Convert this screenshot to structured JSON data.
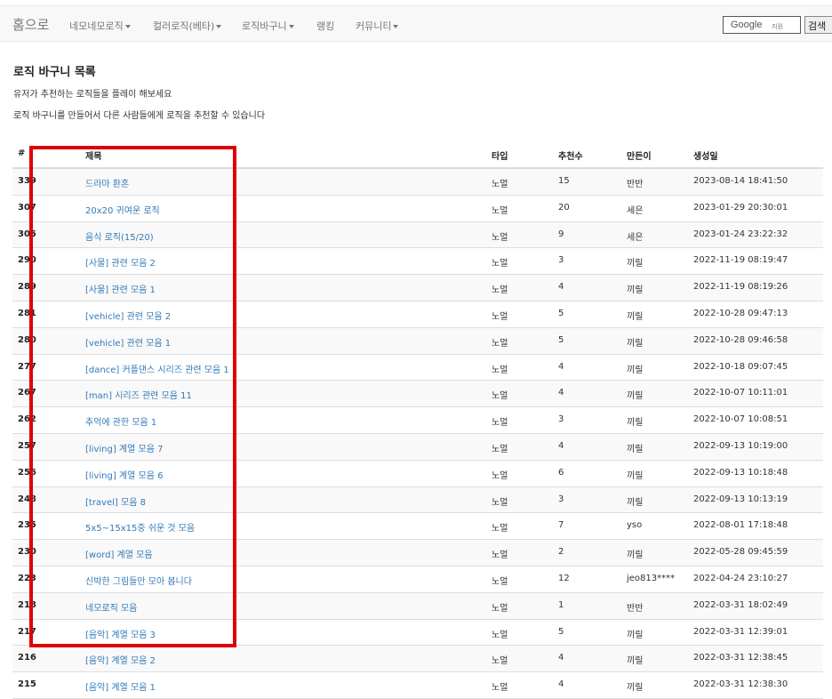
{
  "navbar": {
    "brand": "홈으로",
    "items": [
      {
        "label": "네모네모로직",
        "dropdown": true
      },
      {
        "label": "컬러로직(베타)",
        "dropdown": true
      },
      {
        "label": "로직바구니",
        "dropdown": true
      },
      {
        "label": "랭킹",
        "dropdown": false
      },
      {
        "label": "커뮤니티",
        "dropdown": true
      }
    ],
    "search": {
      "brand": "Google",
      "sub": "지원",
      "button_label": "검색"
    }
  },
  "page": {
    "title": "로직 바구니 목록",
    "desc1": "유저가 추천하는 로직들을 플레이 해보세요",
    "desc2": "로직 바구니를 만들어서 다른 사람들에게 로직을 추천할 수 있습니다"
  },
  "table": {
    "headers": {
      "id": "#",
      "title": "제목",
      "type": "타입",
      "rec": "추천수",
      "author": "만든이",
      "date": "생성일"
    },
    "rows": [
      {
        "id": "339",
        "title": "드라마 환혼",
        "type": "노멀",
        "rec": "15",
        "author": "반반",
        "date": "2023-08-14 18:41:50"
      },
      {
        "id": "307",
        "title": "20x20 귀여운 로직",
        "type": "노멀",
        "rec": "20",
        "author": "세은",
        "date": "2023-01-29 20:30:01"
      },
      {
        "id": "305",
        "title": "음식 로직(15/20)",
        "type": "노멀",
        "rec": "9",
        "author": "세은",
        "date": "2023-01-24 23:22:32"
      },
      {
        "id": "290",
        "title": "[사물] 관련 모음 2",
        "type": "노멀",
        "rec": "3",
        "author": "끼릴",
        "date": "2022-11-19 08:19:47"
      },
      {
        "id": "289",
        "title": "[사물] 관련 모음 1",
        "type": "노멀",
        "rec": "4",
        "author": "끼릴",
        "date": "2022-11-19 08:19:26"
      },
      {
        "id": "281",
        "title": "[vehicle] 관련 모음 2",
        "type": "노멀",
        "rec": "5",
        "author": "끼릴",
        "date": "2022-10-28 09:47:13"
      },
      {
        "id": "280",
        "title": "[vehicle] 관련 모음 1",
        "type": "노멀",
        "rec": "5",
        "author": "끼릴",
        "date": "2022-10-28 09:46:58"
      },
      {
        "id": "277",
        "title": "[dance] 커플댄스 시리즈 관련 모음 1",
        "type": "노멀",
        "rec": "4",
        "author": "끼릴",
        "date": "2022-10-18 09:07:45"
      },
      {
        "id": "267",
        "title": "[man] 시리즈 관련 모음 11",
        "type": "노멀",
        "rec": "4",
        "author": "끼릴",
        "date": "2022-10-07 10:11:01"
      },
      {
        "id": "262",
        "title": "추억에 관한 모음 1",
        "type": "노멀",
        "rec": "3",
        "author": "끼릴",
        "date": "2022-10-07 10:08:51"
      },
      {
        "id": "257",
        "title": "[living] 계열 모음 7",
        "type": "노멀",
        "rec": "4",
        "author": "끼릴",
        "date": "2022-09-13 10:19:00"
      },
      {
        "id": "256",
        "title": "[living] 계열 모음 6",
        "type": "노멀",
        "rec": "6",
        "author": "끼릴",
        "date": "2022-09-13 10:18:48"
      },
      {
        "id": "248",
        "title": "[travel] 모음 8",
        "type": "노멀",
        "rec": "3",
        "author": "끼릴",
        "date": "2022-09-13 10:13:19"
      },
      {
        "id": "235",
        "title": "5x5~15x15중 쉬운 것 모음",
        "type": "노멀",
        "rec": "7",
        "author": "yso",
        "date": "2022-08-01 17:18:48"
      },
      {
        "id": "230",
        "title": "[word] 계열 모음",
        "type": "노멀",
        "rec": "2",
        "author": "끼릴",
        "date": "2022-05-28 09:45:59"
      },
      {
        "id": "223",
        "title": "신박한 그림들만 모아 봅니다",
        "type": "노멀",
        "rec": "12",
        "author": "jeo813****",
        "date": "2022-04-24 23:10:27"
      },
      {
        "id": "218",
        "title": "네모로직 모음",
        "type": "노멀",
        "rec": "1",
        "author": "반반",
        "date": "2022-03-31 18:02:49"
      },
      {
        "id": "217",
        "title": "[음악] 계열 모음 3",
        "type": "노멀",
        "rec": "5",
        "author": "끼릴",
        "date": "2022-03-31 12:39:01"
      },
      {
        "id": "216",
        "title": "[음악] 계열 모음 2",
        "type": "노멀",
        "rec": "4",
        "author": "끼릴",
        "date": "2022-03-31 12:38:45"
      },
      {
        "id": "215",
        "title": "[음악] 계열 모음 1",
        "type": "노멀",
        "rec": "4",
        "author": "끼릴",
        "date": "2022-03-31 12:38:30"
      }
    ]
  },
  "colors": {
    "link": "#337ab7",
    "highlight": "#e00000",
    "stripe": "#f9f9f9"
  }
}
